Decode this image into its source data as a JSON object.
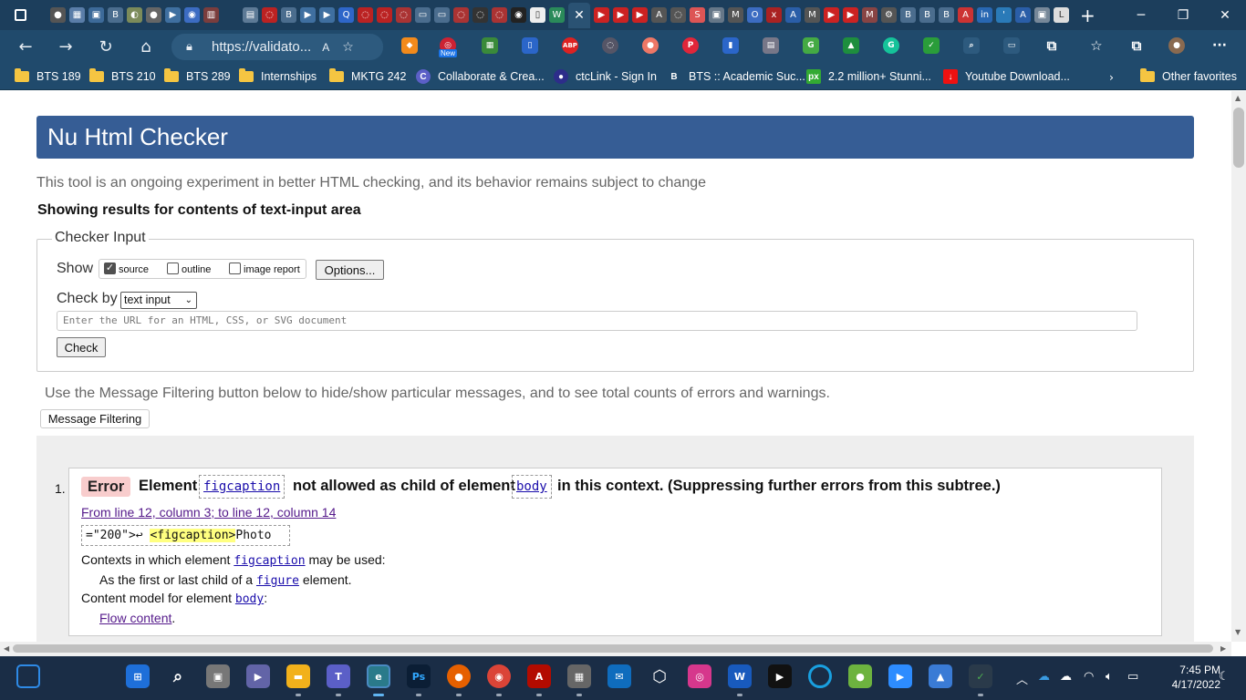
{
  "browser": {
    "url": "https://validato...",
    "window_controls": {
      "minimize": "─",
      "maximize": "❐",
      "close": "✕"
    },
    "new_tab": "+",
    "active_tab_close": "✕",
    "nav_icons": {
      "back": "←",
      "forward": "→",
      "refresh": "↻",
      "home": "⌂"
    },
    "ext_badges": {
      "new": "New",
      "abp": "ABP"
    },
    "more": "···"
  },
  "favorites": [
    {
      "label": "BTS 189",
      "icon": "folder-icon"
    },
    {
      "label": "BTS 210",
      "icon": "folder-icon"
    },
    {
      "label": "BTS 289",
      "icon": "folder-icon"
    },
    {
      "label": "Internships",
      "icon": "folder-icon"
    },
    {
      "label": "MKTG 242",
      "icon": "folder-icon"
    },
    {
      "label": "Collaborate & Crea...",
      "icon": "collaborate-icon"
    },
    {
      "label": "ctcLink - Sign In",
      "icon": "ctclink-icon"
    },
    {
      "label": "BTS :: Academic Suc...",
      "icon": "bts-icon"
    },
    {
      "label": "2.2 million+ Stunni...",
      "icon": "px-icon"
    },
    {
      "label": "Youtube Download...",
      "icon": "download-icon"
    },
    {
      "label": "Other favorites",
      "icon": "folder-icon"
    }
  ],
  "page": {
    "title": "Nu Html Checker",
    "intro": "This tool is an ongoing experiment in better HTML checking, and its behavior remains subject to change",
    "showing": "Showing results for contents of text-input area",
    "checker_input": {
      "legend": "Checker Input",
      "show_label": "Show",
      "options": [
        {
          "label": "source",
          "checked": true
        },
        {
          "label": "outline",
          "checked": false
        },
        {
          "label": "image report",
          "checked": false
        }
      ],
      "options_button": "Options...",
      "check_by_label": "Check by",
      "check_by_value": "text input",
      "url_placeholder": "Enter the URL for an HTML, CSS, or SVG document",
      "check_button": "Check"
    },
    "filter_note": "Use the Message Filtering button below to hide/show particular messages, and to see total counts of errors and warnings.",
    "filter_button": "Message Filtering",
    "messages": [
      {
        "number": "1.",
        "type": "Error",
        "text_1": "Element",
        "element": "figcaption",
        "text_2": "not allowed as child of element",
        "parent": "body",
        "text_3": "in this context. (Suppressing further errors from this subtree.)",
        "location": "From line 12, column 3; to line 12, column 14",
        "extract_before": "=\"200\">↩  ",
        "extract_highlight": "<figcaption>",
        "extract_after": "Photo",
        "contexts_prefix": "Contexts in which element",
        "contexts_element": "figcaption",
        "contexts_suffix": "may be used:",
        "context_item_prefix": "As the first or last child of a",
        "context_item_element": "figure",
        "context_item_suffix": "element.",
        "model_prefix": "Content model for element",
        "model_element": "body",
        "model_suffix": ":",
        "model_item": "Flow content",
        "model_item_suffix": "."
      }
    ]
  },
  "taskbar": {
    "time": "7:45 PM",
    "date": "4/17/2022"
  },
  "colors": {
    "header_bg": "#365d95",
    "error_badge": "#f8cdcd",
    "highlight": "#ffff80",
    "chrome_tabbar": "#1c3e5c",
    "chrome_toolbar": "#204a6c"
  }
}
